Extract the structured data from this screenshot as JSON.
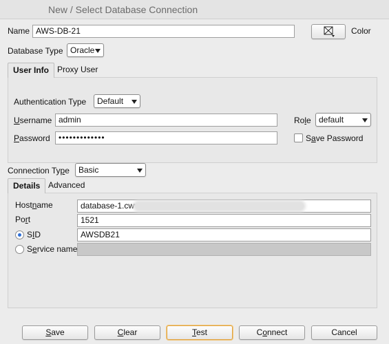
{
  "window": {
    "title": "New / Select Database Connection"
  },
  "name_row": {
    "label": "Name",
    "value": "AWS-DB-21",
    "color_label": "Color"
  },
  "db_type": {
    "label": "Database Type",
    "value": "Oracle"
  },
  "auth_tabs": [
    {
      "label": "User Info",
      "active": true
    },
    {
      "label": "Proxy User",
      "active": false
    }
  ],
  "user_info": {
    "auth_type_label": "Authentication Type",
    "auth_type_value": "Default",
    "username_label": "Username",
    "username_value": "admin",
    "password_label": "Password",
    "password_value": "•••••••••••••",
    "role_label": "Role",
    "role_value": "default",
    "save_password_label": "Save Password",
    "save_password_checked": false
  },
  "connection_type": {
    "label": "Connection Type",
    "value": "Basic"
  },
  "conn_tabs": [
    {
      "label": "Details",
      "active": true
    },
    {
      "label": "Advanced",
      "active": false
    }
  ],
  "details": {
    "hostname_label": "Hostname",
    "hostname_value": "database-1.cwv",
    "port_label": "Port",
    "port_value": "1521",
    "sid_label": "SID",
    "sid_value": "AWSDB21",
    "sid_selected": true,
    "service_name_label": "Service name",
    "service_name_value": ""
  },
  "buttons": {
    "save": "Save",
    "clear": "Clear",
    "test": "Test",
    "connect": "Connect",
    "cancel": "Cancel"
  },
  "colors": {
    "accent": "#2f6fd6",
    "focus_ring": "#e0a341",
    "window_bg": "#ececec"
  }
}
